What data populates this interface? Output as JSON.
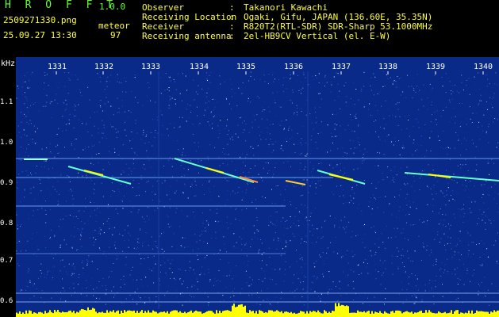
{
  "header": {
    "app_title": "H R O F F T",
    "version": "1.0.0",
    "filename": "2509271330.png",
    "meteor_label": "meteor",
    "datetime": "25.09.27 13:30",
    "meteor_count": "97",
    "rows": [
      {
        "label": "Observer",
        "value": "Takanori Kawachi"
      },
      {
        "label": "Receiving Location",
        "value": "Ogaki, Gifu, JAPAN (136.60E, 35.35N)"
      },
      {
        "label": "Receiver",
        "value": "R820T2(RTL-SDR) SDR-Sharp 53.1000MHz"
      },
      {
        "label": "Receiving antenna",
        "value": "2el-HB9CV Vertical (el. E-W)"
      }
    ],
    "colon": ":"
  },
  "axis": {
    "unit": "kHz",
    "time_ticks": [
      "1331",
      "1332",
      "1333",
      "1334",
      "1335",
      "1336",
      "1337",
      "1338",
      "1339",
      "1340"
    ],
    "freq_ticks": [
      "1.1",
      "1.0",
      "0.9",
      "0.8",
      "0.7",
      "0.6"
    ]
  },
  "colors": {
    "background": "#0a2a8a",
    "header_green": "#66ff33",
    "header_yellow": "#ffff33",
    "signal_yellow": "#ffff00",
    "signal_cyan": "#66ffcc"
  }
}
